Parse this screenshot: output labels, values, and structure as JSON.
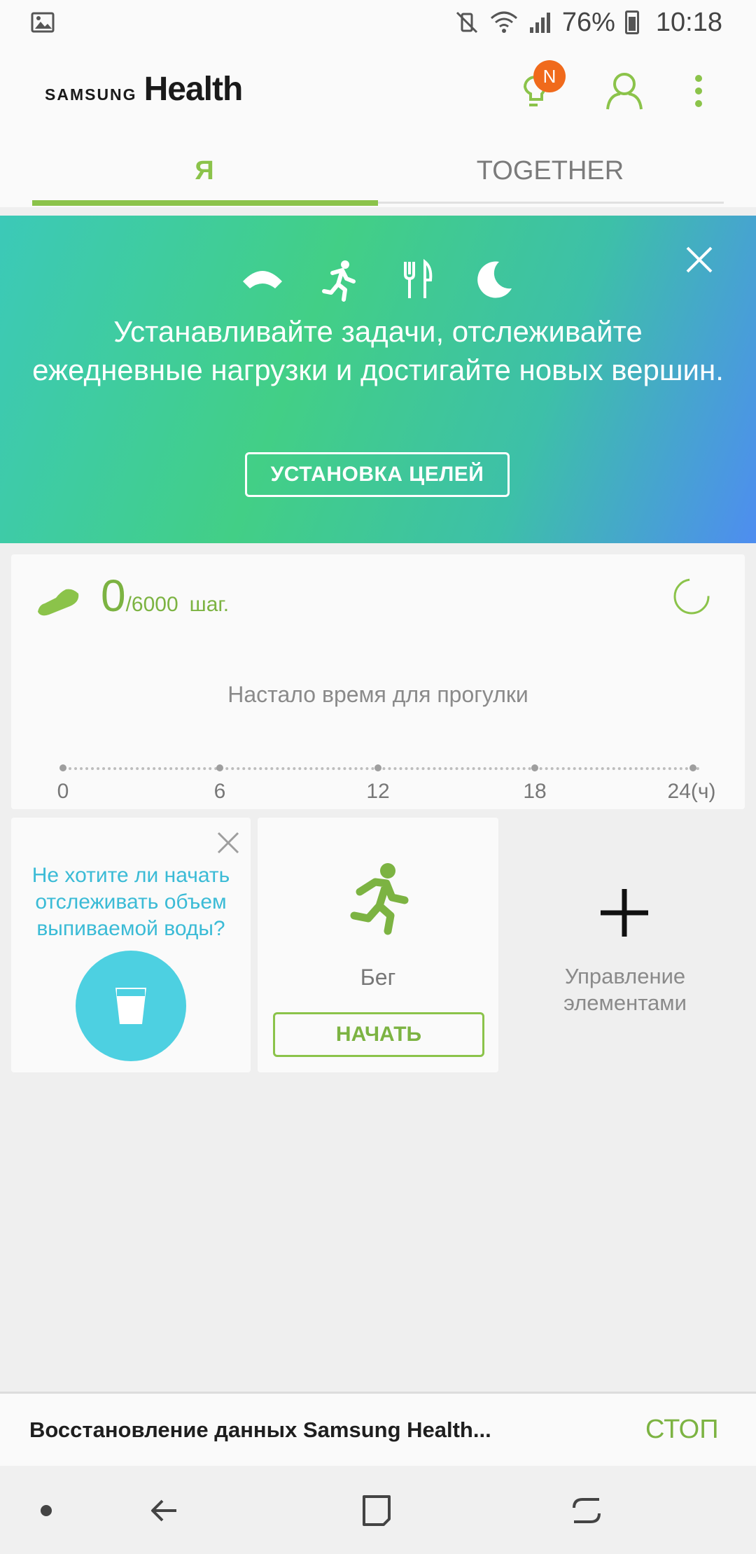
{
  "status_bar": {
    "battery": "76%",
    "time": "10:18",
    "icons": [
      "gallery-icon",
      "mute-icon",
      "wifi-icon",
      "signal-icon",
      "battery-icon"
    ]
  },
  "app_bar": {
    "logo_samsung": "SAMSUNG",
    "logo_health": "Health",
    "notification_badge": "N",
    "icons": [
      "lightbulb-icon",
      "profile-icon",
      "more-vert-icon"
    ]
  },
  "tabs": {
    "me": "Я",
    "together": "TOGETHER",
    "active": "me"
  },
  "banner": {
    "icons": [
      "scale-icon",
      "run-icon",
      "fork-knife-icon",
      "moon-icon"
    ],
    "text": "Устанавливайте задачи, отслеживайте ежедневные нагрузки и достигайте новых вершин.",
    "button": "УСТАНОВКА ЦЕЛЕЙ"
  },
  "steps": {
    "count": "0",
    "goal": "/6000",
    "unit": "шаг.",
    "message": "Настало время для прогулки",
    "timeline_labels": [
      "0",
      "6",
      "12",
      "18",
      "24(ч)"
    ]
  },
  "water_tile": {
    "text": "Не хотите ли начать отслеживать объем выпиваемой воды?"
  },
  "run_tile": {
    "label": "Бег",
    "button": "НАЧАТЬ"
  },
  "manage_tile": {
    "label": "Управление элементами"
  },
  "snackbar": {
    "text": "Восстановление данных Samsung Health...",
    "action": "СТОП"
  },
  "colors": {
    "accent_green": "#8bc34a",
    "water_blue": "#4dd0e1",
    "badge_orange": "#f06a1c"
  }
}
